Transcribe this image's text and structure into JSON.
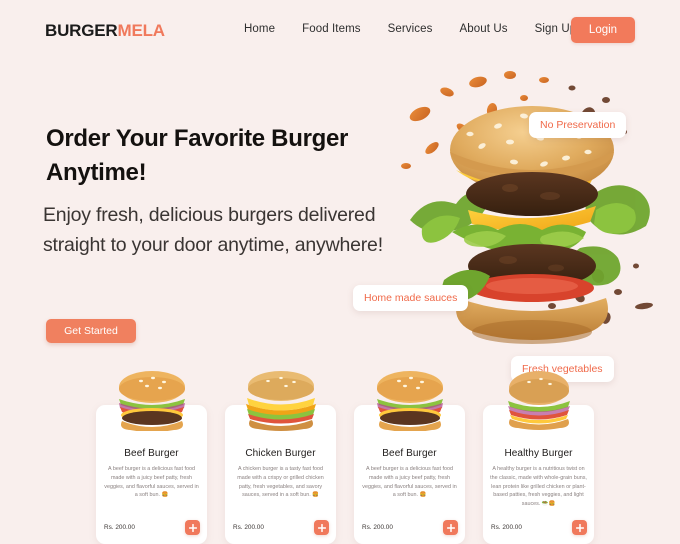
{
  "nav": {
    "logo_first": "BURGER",
    "logo_second": "MELA",
    "links": [
      {
        "label": "Home"
      },
      {
        "label": "Food Items"
      },
      {
        "label": "Services"
      },
      {
        "label": "About Us"
      },
      {
        "label": "Sign Up"
      }
    ],
    "login_label": "Login",
    "login_color": "#f27a5b"
  },
  "hero": {
    "title": "Order Your Favorite Burger Anytime!",
    "subtitle": "Enjoy fresh, delicious burgers delivered straight to your door anytime, anywhere!",
    "cta_label": "Get Started",
    "cta_color": "#f0805f",
    "badges": [
      {
        "label": "No Preservation"
      },
      {
        "label": "Home made sauces"
      },
      {
        "label": "Fresh vegetables"
      }
    ],
    "badge_text_color": "#f06a4a"
  },
  "cards": [
    {
      "title": "Beef Burger",
      "description": "A beef burger is a delicious fast food made with a juicy beef patty, fresh veggies, and flavorful sauces, served in a soft bun. 🍔",
      "price": "Rs. 200.00",
      "add_icon": "plus-icon"
    },
    {
      "title": "Chicken Burger",
      "description": "A chicken burger is a tasty fast food made with a crispy or grilled chicken patty, fresh vegetables, and savory sauces, served in a soft bun. 🍔",
      "price": "Rs. 200.00",
      "add_icon": "plus-icon"
    },
    {
      "title": "Beef Burger",
      "description": "A beef burger is a delicious fast food made with a juicy beef patty, fresh veggies, and flavorful sauces, served in a soft bun. 🍔",
      "price": "Rs. 200.00",
      "add_icon": "plus-icon"
    },
    {
      "title": "Healthy Burger",
      "description": "A healthy burger is a nutritious twist on the classic, made with whole-grain buns, lean protein like grilled chicken or plant-based patties, fresh veggies, and light sauces. 🥗🍔",
      "price": "Rs. 200.00",
      "add_icon": "plus-icon"
    }
  ],
  "theme": {
    "background": "#f9efed",
    "accent": "#f0795c"
  }
}
